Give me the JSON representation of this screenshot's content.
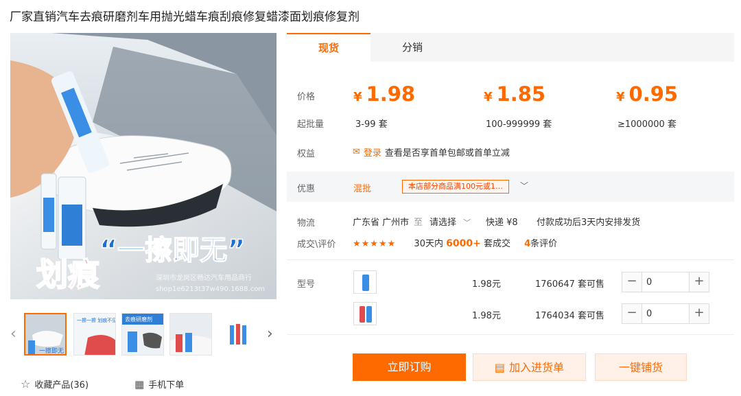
{
  "title": "厂家直销汽车去痕研磨剂车用抛光蜡车痕刮痕修复蜡漆面划痕修复剂",
  "image": {
    "slogan": "“一擦即无”",
    "big_text": "划痕",
    "watermark_1": "深圳市龙岗区畅达汽车用品商行",
    "watermark_2": "shop1e6213t37w490.1688.com"
  },
  "thumbs": [
    {
      "icon": "product-main-thumb"
    },
    {
      "text": "一擦一擦 划痕不见了"
    },
    {
      "text": "去痕研磨剂"
    },
    {
      "icon": "product-car-thumb"
    },
    {
      "icon": "product-tubes-thumb"
    }
  ],
  "bottom_links": {
    "favorite": "收藏产品(36)",
    "mobile": "手机下单"
  },
  "tabs": [
    "现货",
    "分销"
  ],
  "labels": {
    "price": "价格",
    "min_qty": "起批量",
    "rights": "权益",
    "promo": "优惠",
    "logistics": "物流",
    "sales": "成交\\评价",
    "model": "型号"
  },
  "prices": [
    {
      "currency": "¥",
      "value": "1.98",
      "qty": "3-99 套"
    },
    {
      "currency": "¥",
      "value": "1.85",
      "qty": "100-999999 套"
    },
    {
      "currency": "¥",
      "value": "0.95",
      "qty": "≥1000000 套"
    }
  ],
  "rights": {
    "login": "登录",
    "text": "查看是否享首单包邮或首单立减"
  },
  "promo": {
    "type": "混批",
    "tag": "本店部分商品满100元或1…"
  },
  "logistics": {
    "from": "广东省 广州市",
    "to_word": "至",
    "select": "请选择",
    "express": "快递 ¥8",
    "ship": "付款成功后3天内安排发货"
  },
  "sales": {
    "stars": "★★★★★",
    "period": "30天内",
    "count": "6000+",
    "unit": "套成交",
    "reviews": "4",
    "reviews_unit": "条评价"
  },
  "skus": [
    {
      "price": "1.98元",
      "stock": "1760647 套可售",
      "qty": "0",
      "accent": "#3a8ee6"
    },
    {
      "price": "1.98元",
      "stock": "1764034 套可售",
      "qty": "0",
      "accent": "#e04b4b"
    }
  ],
  "actions": {
    "buy": "立即订购",
    "cart": "加入进货单",
    "dist": "一键铺货"
  },
  "colors": {
    "accent": "#ff6a00"
  }
}
